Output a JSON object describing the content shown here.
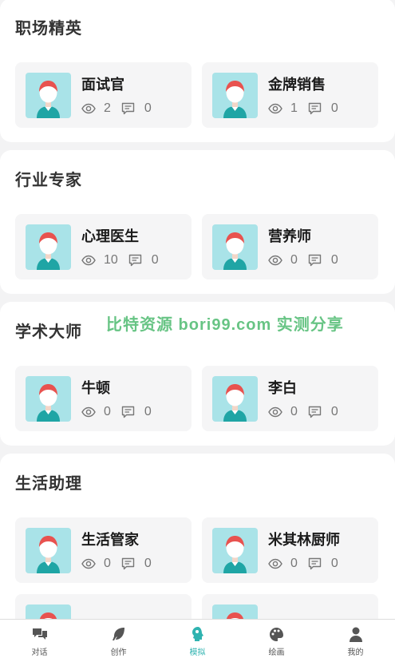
{
  "sections": [
    {
      "title": "职场精英",
      "cards": [
        {
          "name": "面试官",
          "views": "2",
          "comments": "0"
        },
        {
          "name": "金牌销售",
          "views": "1",
          "comments": "0"
        }
      ]
    },
    {
      "title": "行业专家",
      "cards": [
        {
          "name": "心理医生",
          "views": "10",
          "comments": "0"
        },
        {
          "name": "营养师",
          "views": "0",
          "comments": "0"
        }
      ]
    },
    {
      "title": "学术大师",
      "cards": [
        {
          "name": "牛顿",
          "views": "0",
          "comments": "0"
        },
        {
          "name": "李白",
          "views": "0",
          "comments": "0"
        }
      ]
    },
    {
      "title": "生活助理",
      "cards": [
        {
          "name": "生活管家",
          "views": "0",
          "comments": "0"
        },
        {
          "name": "米其林厨师",
          "views": "0",
          "comments": "0"
        }
      ]
    }
  ],
  "watermark": "比特资源 bori99.com 实测分享",
  "tabbar": {
    "tabs": [
      {
        "label": "对话",
        "icon": "chat-icon"
      },
      {
        "label": "创作",
        "icon": "leaf-icon"
      },
      {
        "label": "模拟",
        "icon": "head-icon"
      },
      {
        "label": "绘画",
        "icon": "palette-icon"
      },
      {
        "label": "我的",
        "icon": "user-icon"
      }
    ],
    "active_index": 2
  },
  "colors": {
    "accent": "#2fb3b0",
    "avatar_bg": "#a9e3e8",
    "avatar_hair": "#e8524f",
    "watermark": "#5bbf7a"
  }
}
